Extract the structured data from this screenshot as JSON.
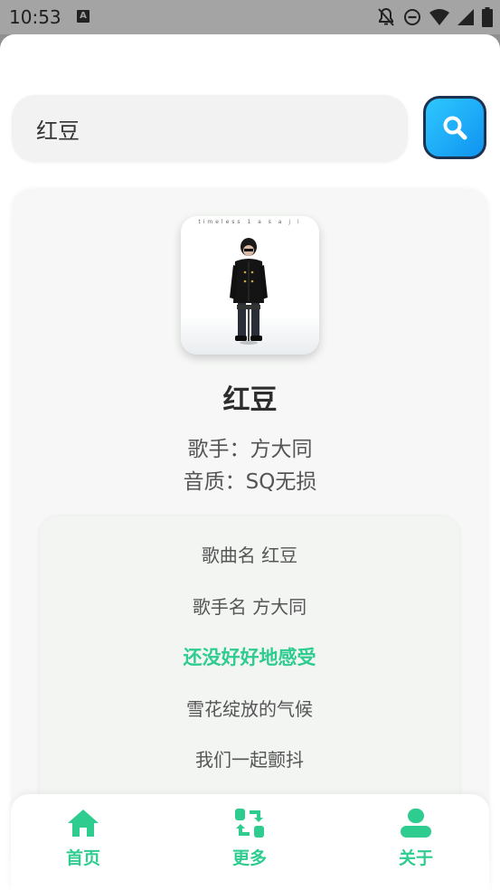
{
  "status_bar": {
    "time": "10:53",
    "notification_letter": "A"
  },
  "search": {
    "value": "红豆",
    "icon": "search-icon"
  },
  "song": {
    "cover_text": "timeless 1 a s a j i",
    "title": "红豆",
    "singer": "歌手：方大同",
    "quality": "音质：SQ无损"
  },
  "lyrics": {
    "lines": [
      "歌曲名 红豆",
      "歌手名 方大同",
      "还没好好地感受",
      "雪花绽放的气候",
      "我们一起颤抖"
    ],
    "active_index": 2
  },
  "nav": {
    "items": [
      {
        "label": "首页",
        "icon": "home-icon"
      },
      {
        "label": "更多",
        "icon": "refresh-icon"
      },
      {
        "label": "关于",
        "icon": "user-icon"
      }
    ]
  },
  "colors": {
    "accent": "#2ecc8f",
    "search_button": "#1093f0"
  }
}
